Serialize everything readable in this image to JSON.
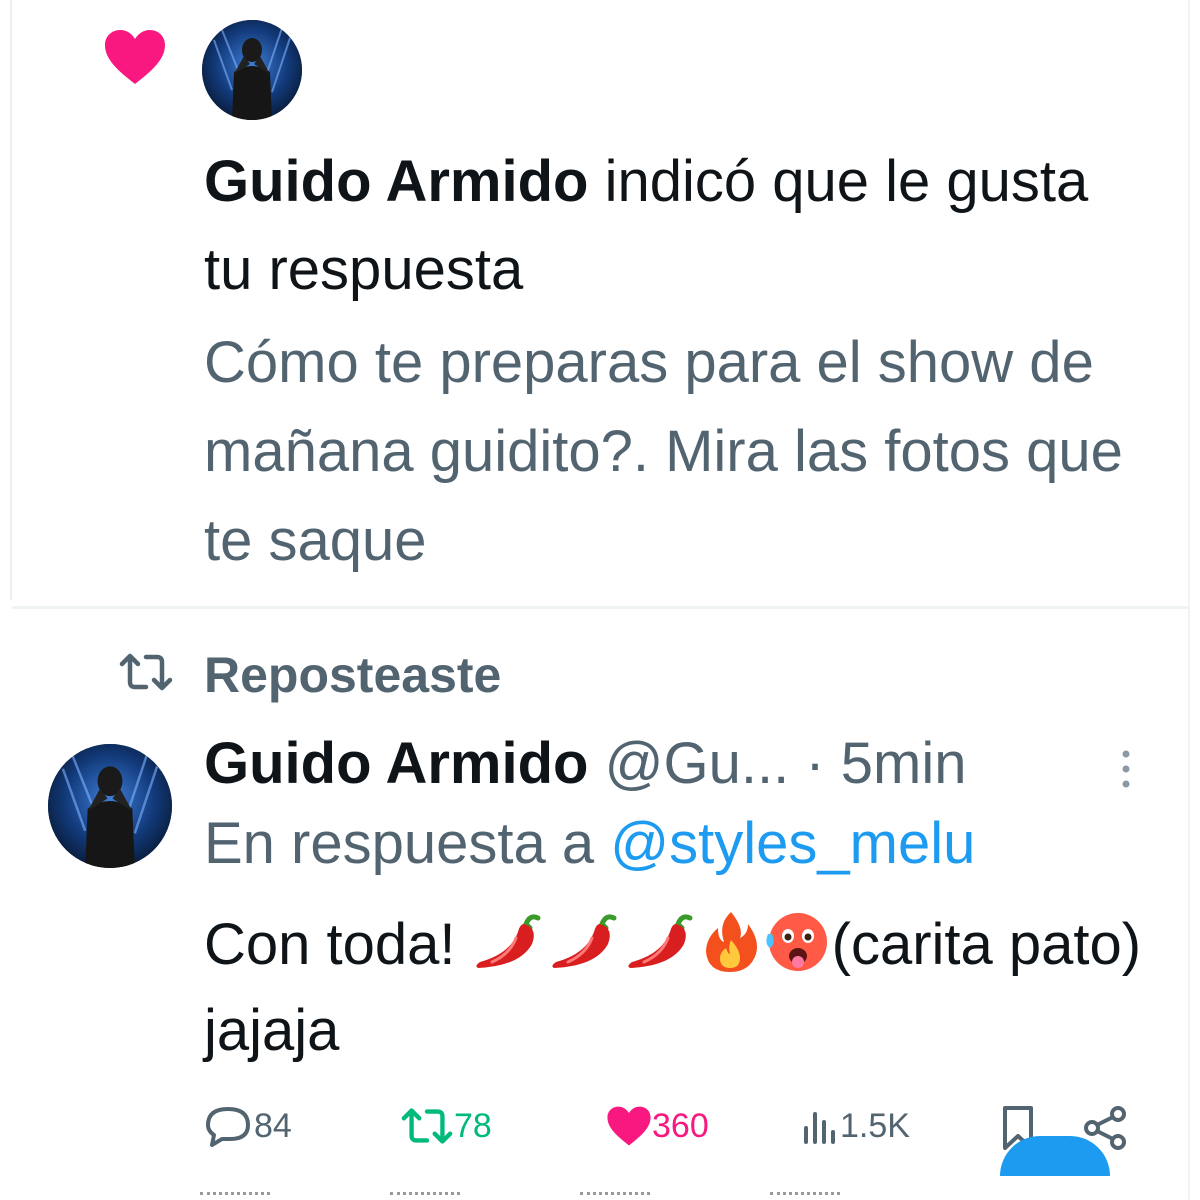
{
  "notification": {
    "actor_name": "Guido Armido",
    "action_text": " indicó que le gusta tu respuesta",
    "quoted_reply": "Cómo te preparas para el show de mañana guidito?. Mira las fotos que te saque",
    "icon": "heart-icon",
    "icon_color": "#f91880"
  },
  "repost_header": {
    "label": "Reposteaste",
    "icon": "repost-icon"
  },
  "post": {
    "author_name": "Guido Armido",
    "handle": "@Gu...",
    "separator": " · ",
    "time": "5min",
    "reply_prefix": "En respuesta a ",
    "reply_to": "@styles_melu",
    "text_start": "Con toda! ",
    "emojis": [
      "hot-pepper",
      "hot-pepper",
      "hot-pepper",
      "fire",
      "hot-face"
    ],
    "text_end": "(carita pato) jajaja"
  },
  "actions": {
    "replies": "84",
    "reposts": "78",
    "likes": "360",
    "views": "1.5K"
  },
  "colors": {
    "primary_text": "#0f1419",
    "secondary_text": "#536471",
    "link": "#1d9bf0",
    "like": "#f91880",
    "repost": "#00ba7c"
  }
}
